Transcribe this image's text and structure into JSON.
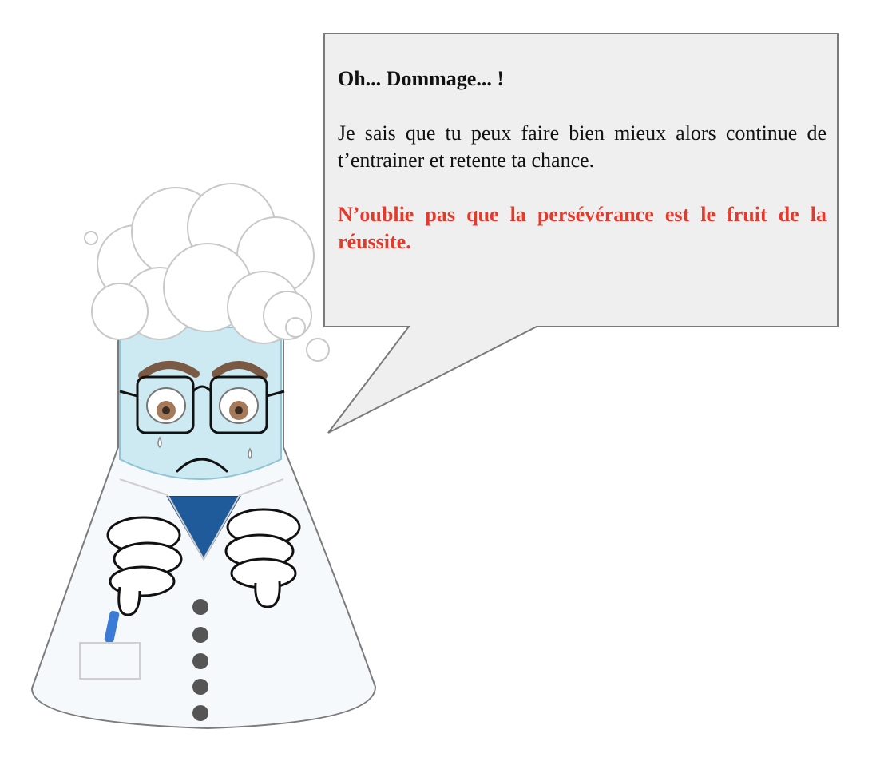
{
  "bubble": {
    "title": "Oh... Dommage... !",
    "message": "Je sais que tu peux faire bien mieux alors continue de t’entrainer et retente ta chance.",
    "motto": "N’oublie pas que la persévérance est le fruit de la réussite."
  },
  "colors": {
    "bubble_fill": "#efefef",
    "bubble_border": "#7a7a7a",
    "motto_red": "#e23b2e",
    "flask_liquid": "#cdeaf3",
    "sweater_blue": "#1f5a9a"
  }
}
